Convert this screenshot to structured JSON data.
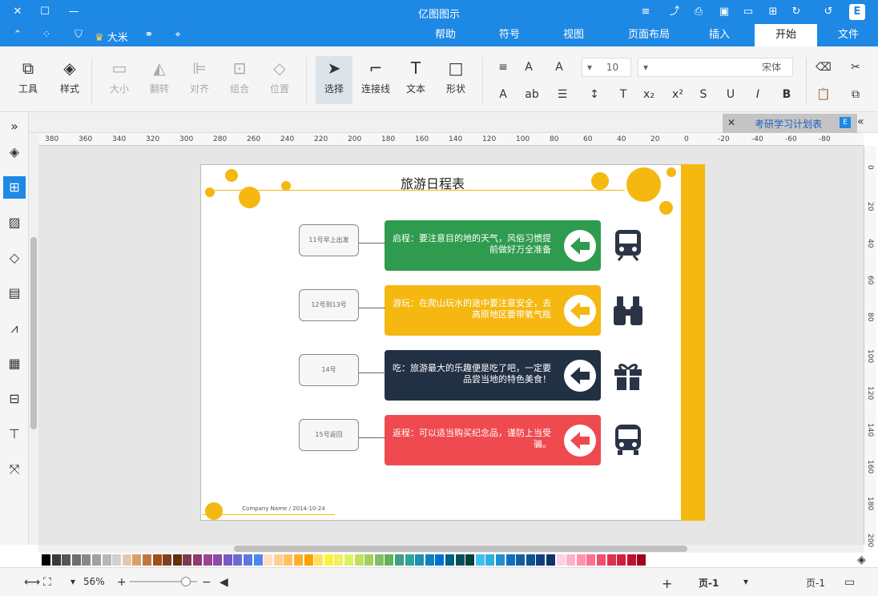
{
  "window": {
    "title": "亿图图示"
  },
  "menu": {
    "tabs": [
      "文件",
      "开始",
      "插入",
      "页面布局",
      "视图",
      "符号",
      "帮助"
    ],
    "active": "开始",
    "user": "大米"
  },
  "ribbon": {
    "tools": [
      {
        "label": "工具"
      },
      {
        "label": "样式"
      },
      {
        "label": "大小"
      },
      {
        "label": "翻转"
      },
      {
        "label": "对齐"
      },
      {
        "label": "组合"
      },
      {
        "label": "位置"
      },
      {
        "label": "选择"
      },
      {
        "label": "连接线"
      },
      {
        "label": "文本"
      },
      {
        "label": "形状"
      }
    ],
    "font_name": "宋体",
    "font_size": "10"
  },
  "document": {
    "tab_title": "考研学习计划表"
  },
  "diagram": {
    "title": "旅游日程表",
    "rows": [
      {
        "text": "启程：要注意目的地的天气，风俗习惯提前做好万全准备",
        "note": "11号早上出发",
        "color": "#2e9b4e",
        "icon": "train-icon"
      },
      {
        "text": "游玩：在爬山玩水的途中要注意安全，去高原地区要带氧气瓶",
        "note": "12号到13号",
        "color": "#f5b811",
        "icon": "binoculars-icon"
      },
      {
        "text": "吃：旅游最大的乐趣便是吃了吧，一定要品尝当地的特色美食！",
        "note": "14号",
        "color": "#223044",
        "icon": "gift-icon"
      },
      {
        "text": "返程：可以适当购买纪念品，谨防上当受骗。",
        "note": "15号返回",
        "color": "#ef4a4f",
        "icon": "bus-icon"
      }
    ],
    "footer": "Company Name / 2014-10-24"
  },
  "ruler": {
    "h": [
      "380",
      "360",
      "340",
      "320",
      "300",
      "280",
      "260",
      "240",
      "220",
      "200",
      "180",
      "160",
      "140",
      "120",
      "100",
      "80",
      "60",
      "40",
      "20",
      "0",
      "-20",
      "-40",
      "-60",
      "-80"
    ],
    "v": [
      "0",
      "20",
      "40",
      "60",
      "80",
      "100",
      "120",
      "140",
      "160",
      "180",
      "200"
    ]
  },
  "status": {
    "page_label": "页-1",
    "page_tab": "页-1",
    "zoom": "56%",
    "add": "+"
  },
  "palette": [
    "#000000",
    "#3a3a3a",
    "#555555",
    "#6e6e6e",
    "#888888",
    "#a0a0a0",
    "#b8b8b8",
    "#d0d0d0",
    "#e6c8a8",
    "#d4a070",
    "#c07840",
    "#a05020",
    "#804020",
    "#603010",
    "#7a3a50",
    "#903a70",
    "#a04090",
    "#8a4aa8",
    "#7a5ac0",
    "#6a6ad0",
    "#5a7ae0",
    "#4a8af0",
    "#ffe0c0",
    "#ffd090",
    "#ffc060",
    "#ffb030",
    "#ffa000",
    "#ffe060",
    "#fff040",
    "#f0f060",
    "#e0f060",
    "#c0e060",
    "#a0d060",
    "#80c060",
    "#60b060",
    "#40a080",
    "#30a0a0",
    "#2090b0",
    "#1080c0",
    "#0070d0",
    "#006080",
    "#005060",
    "#004040",
    "#40c0f0",
    "#30b0e0",
    "#2090d0",
    "#1070c0",
    "#1060a0",
    "#105090",
    "#104080",
    "#103070",
    "#ffd0e0",
    "#ffb0c8",
    "#ff90b0",
    "#ff7090",
    "#f05070",
    "#e03050",
    "#d02040",
    "#c01030",
    "#a00020"
  ]
}
